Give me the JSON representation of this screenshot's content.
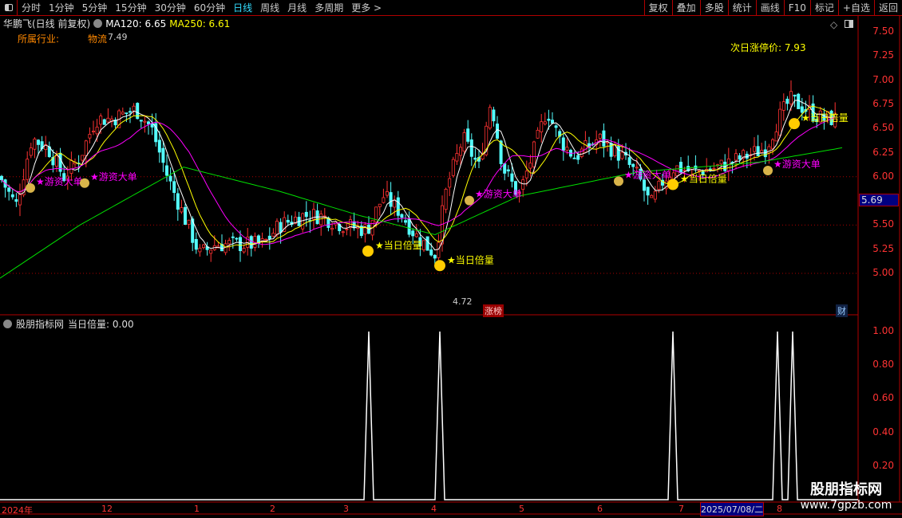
{
  "toolbar": {
    "periods": [
      "分时",
      "1分钟",
      "5分钟",
      "15分钟",
      "30分钟",
      "60分钟",
      "日线",
      "周线",
      "月线",
      "多周期",
      "更多 >"
    ],
    "active": "日线",
    "tools": [
      "复权",
      "叠加",
      "多股",
      "统计",
      "画线",
      "F10",
      "标记",
      "+自选",
      "返回"
    ]
  },
  "header": {
    "title": "华鹏飞(日线 前复权)",
    "ma120": "MA120: 6.65",
    "ma250": "MA250: 6.61",
    "industry_label": "所属行业:",
    "industry": "物流"
  },
  "price_axis": [
    "7.50",
    "7.25",
    "7.00",
    "6.75",
    "6.50",
    "6.25",
    "6.00",
    "5.50",
    "5.25",
    "5.00"
  ],
  "current_price": "5.69",
  "high_label": "7.49",
  "low_label": "4.72",
  "limit_up": "次日涨停价: 7.93",
  "badges": {
    "zhangbang": "涨榜",
    "cai": "财"
  },
  "signals": {
    "big_money": "★游资大单",
    "double_volume": "★当日倍量"
  },
  "lower": {
    "title": "股朋指标网",
    "indicator": "当日倍量: 0.00",
    "axis": [
      "1.00",
      "0.80",
      "0.60",
      "0.40",
      "0.20"
    ]
  },
  "dates": [
    "2024年",
    "12",
    "1",
    "2",
    "3",
    "4",
    "5",
    "6",
    "7",
    "2025/07/08/二",
    "8"
  ],
  "watermark": {
    "name": "股朋指标网",
    "url": "www.7gpzb.com"
  },
  "colors": {
    "up": "#ff3232",
    "down": "#54ffff",
    "ma_short": "#ffffff",
    "ma_mid": "#ffff00",
    "ma_long": "#ff00ff",
    "ma250": "#00e000",
    "axis": "#b00000"
  },
  "chart_data": {
    "type": "candlestick",
    "price_range": [
      4.72,
      7.5
    ],
    "anchors": [
      [
        0,
        6.0
      ],
      [
        20,
        5.7
      ],
      [
        40,
        6.4
      ],
      [
        60,
        6.3
      ],
      [
        80,
        6.0
      ],
      [
        100,
        6.2
      ],
      [
        120,
        6.6
      ],
      [
        140,
        6.6
      ],
      [
        170,
        6.7
      ],
      [
        190,
        6.5
      ],
      [
        210,
        6.0
      ],
      [
        230,
        5.6
      ],
      [
        250,
        5.2
      ],
      [
        270,
        5.3
      ],
      [
        290,
        5.3
      ],
      [
        310,
        5.3
      ],
      [
        330,
        5.3
      ],
      [
        350,
        5.5
      ],
      [
        380,
        5.6
      ],
      [
        400,
        5.6
      ],
      [
        430,
        5.5
      ],
      [
        460,
        5.45
      ],
      [
        480,
        5.8
      ],
      [
        500,
        5.65
      ],
      [
        520,
        5.4
      ],
      [
        545,
        5.2
      ],
      [
        560,
        5.9
      ],
      [
        580,
        6.4
      ],
      [
        600,
        6.1
      ],
      [
        615,
        6.8
      ],
      [
        630,
        6.1
      ],
      [
        650,
        5.8
      ],
      [
        670,
        6.3
      ],
      [
        685,
        6.7
      ],
      [
        700,
        6.4
      ],
      [
        720,
        6.2
      ],
      [
        750,
        6.4
      ],
      [
        780,
        6.2
      ],
      [
        800,
        6.0
      ],
      [
        815,
        5.7
      ],
      [
        830,
        5.95
      ],
      [
        845,
        6.1
      ],
      [
        870,
        6.05
      ],
      [
        900,
        6.1
      ],
      [
        930,
        6.2
      ],
      [
        960,
        6.3
      ],
      [
        975,
        6.6
      ],
      [
        990,
        6.8
      ],
      [
        1010,
        6.7
      ],
      [
        1030,
        6.6
      ],
      [
        1045,
        6.6
      ]
    ],
    "ma250": [
      [
        0,
        4.95
      ],
      [
        100,
        5.5
      ],
      [
        230,
        6.1
      ],
      [
        350,
        5.85
      ],
      [
        450,
        5.6
      ],
      [
        545,
        5.4
      ],
      [
        650,
        5.8
      ],
      [
        800,
        6.05
      ],
      [
        950,
        6.15
      ],
      [
        1055,
        6.3
      ]
    ],
    "double_volume_spikes": [
      462,
      551,
      843,
      974,
      993
    ],
    "big_money_marks": [
      [
        38,
        5.95
      ],
      [
        106,
        6.0
      ],
      [
        588,
        5.82
      ],
      [
        775,
        6.02
      ],
      [
        962,
        6.13
      ]
    ],
    "double_volume_marks": [
      [
        461,
        5.23
      ],
      [
        551,
        5.08
      ],
      [
        843,
        5.92
      ],
      [
        995,
        6.55
      ]
    ]
  }
}
